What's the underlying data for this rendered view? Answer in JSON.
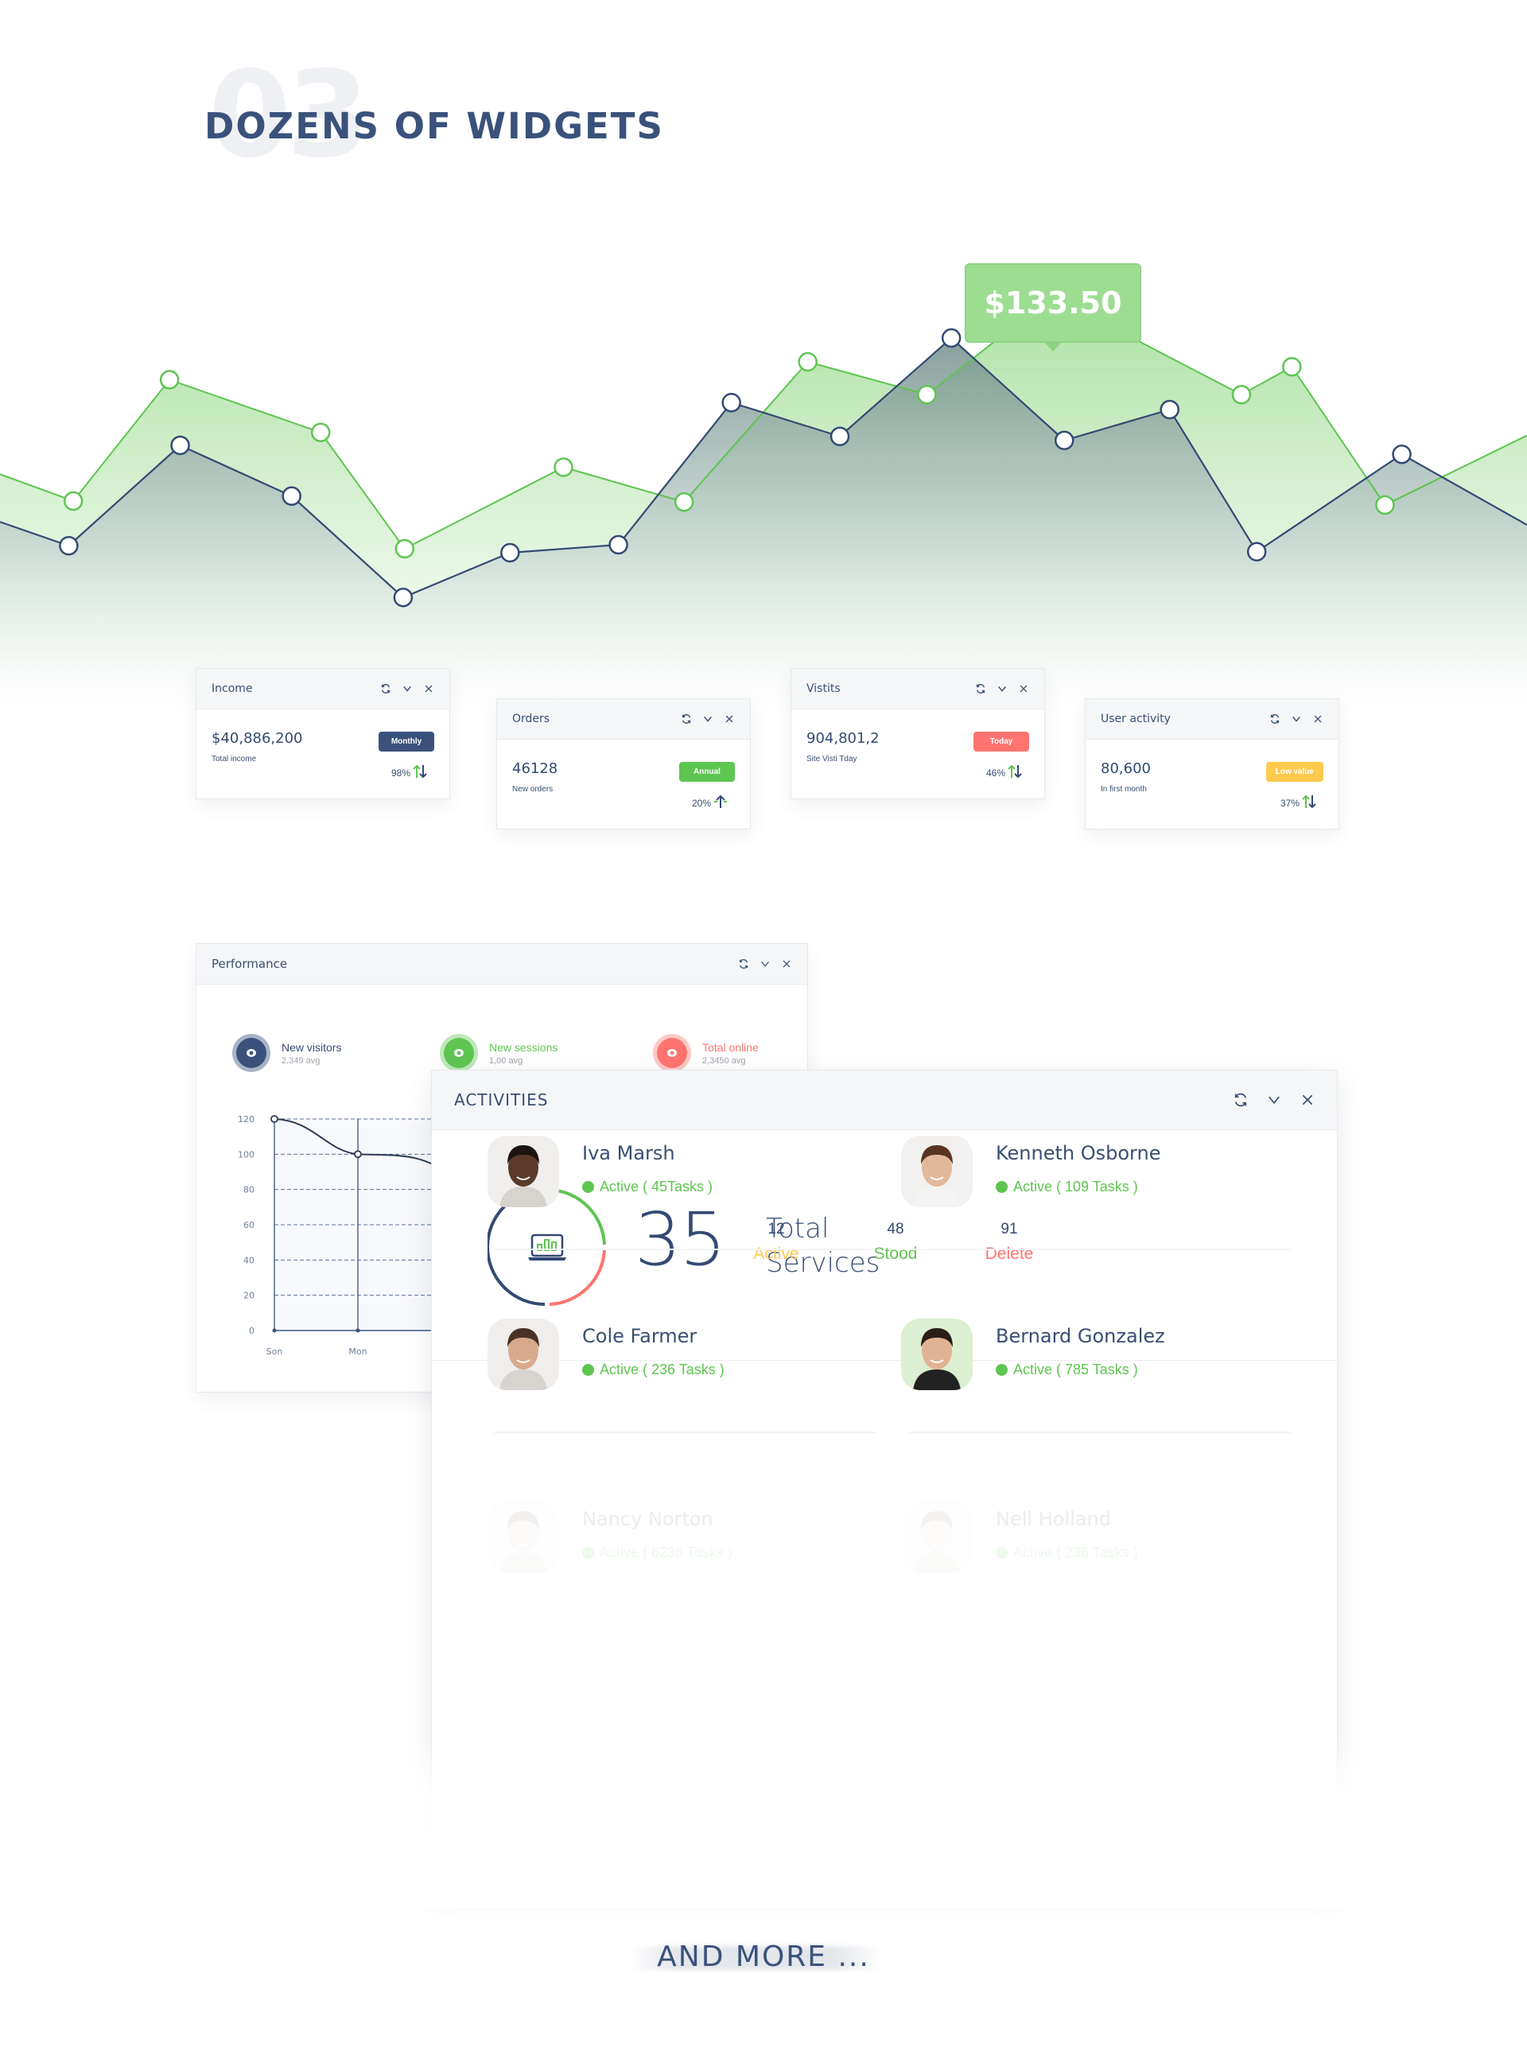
{
  "section": {
    "number": "03",
    "title": "DOZENS OF WIDGETS"
  },
  "colors": {
    "navy": "#344a73",
    "green": "#5ec551",
    "red": "#ff7470",
    "yellow": "#ffc94d",
    "tooltip_green": "#9ddd92"
  },
  "hero_tooltip": {
    "value": "$133.50"
  },
  "chart_data": [
    {
      "type": "area",
      "title": "",
      "xlabel": "",
      "ylabel": "",
      "grid": false,
      "tooltip": {
        "series": "Green",
        "point_index": 9,
        "label": "$133.50"
      },
      "ylim": [
        0,
        480
      ],
      "xlim": [
        0,
        100
      ],
      "series": [
        {
          "name": "Green",
          "color": "#5ec551",
          "x": [
            0,
            4.8,
            11.1,
            21.0,
            26.5,
            36.9,
            44.8,
            52.9,
            60.7,
            68.9,
            81.3,
            84.6,
            90.7,
            100
          ],
          "values": [
            243,
            216,
            338,
            285,
            168,
            250,
            215,
            356,
            323,
            422,
            323,
            351,
            212,
            282
          ]
        },
        {
          "name": "Navy",
          "color": "#344a73",
          "x": [
            0,
            4.5,
            11.8,
            19.1,
            26.4,
            33.4,
            40.5,
            47.9,
            55.0,
            62.3,
            69.7,
            76.6,
            82.3,
            91.8,
            100
          ],
          "values": [
            195,
            171,
            272,
            221,
            119,
            164,
            172,
            315,
            281,
            380,
            277,
            308,
            165,
            263,
            192
          ]
        }
      ]
    },
    {
      "type": "line",
      "title": "Performance",
      "xlabel": "",
      "ylabel": "",
      "grid": true,
      "categories": [
        "Son",
        "Mon"
      ],
      "yticks": [
        0,
        20,
        40,
        60,
        80,
        100,
        120
      ],
      "ylim": [
        0,
        120
      ],
      "series": [
        {
          "name": "Performance",
          "color": "#2f3c55",
          "values": [
            120,
            100,
            90
          ]
        }
      ]
    }
  ],
  "stat_cards": [
    {
      "title": "Income",
      "value": "$40,886,200",
      "label": "Total income",
      "badge": "Monthly",
      "badge_color": "#3a527b",
      "trend": "98%",
      "trend_icon": "up-down-arrows-icon"
    },
    {
      "title": "Orders",
      "value": "46128",
      "label": "New orders",
      "badge": "Annual",
      "badge_color": "#5ec551",
      "trend": "20%",
      "trend_icon": "arrow-up-icon"
    },
    {
      "title": "Vistits",
      "value": "904,801,2",
      "label": "Site Visti Tday",
      "badge": "Today",
      "badge_color": "#ff7470",
      "trend": "46%",
      "trend_icon": "up-down-arrows-icon"
    },
    {
      "title": "User activity",
      "value": "80,600",
      "label": "In first month",
      "badge": "Low value",
      "badge_color": "#ffc94d",
      "trend": "37%",
      "trend_icon": "up-down-arrows-icon"
    }
  ],
  "card_tools": {
    "refresh": "refresh-icon",
    "collapse": "chevron-down-icon",
    "close": "close-icon"
  },
  "performance": {
    "title": "Performance",
    "legend": [
      {
        "label": "New visitors",
        "sub": "2,349 avg",
        "color": "#3a527b",
        "ring": "#a9b3c6",
        "label_color": "#3a4e74"
      },
      {
        "label": "New sessions",
        "sub": "1,00 avg",
        "color": "#5ec551",
        "ring": "#bfe8b9",
        "label_color": "#5ec551"
      },
      {
        "label": "Total online",
        "sub": "2,3450 avg",
        "color": "#ff7470",
        "ring": "#ffc9c7",
        "label_color": "#ff7470"
      }
    ]
  },
  "activities": {
    "title": "ACTIVITIES",
    "total_number": "35",
    "total_label_1": "Total",
    "total_label_2": "Services",
    "icon": "laptop-chart-icon",
    "stats": [
      {
        "number": "12",
        "label": "Active",
        "color": "#ffc94d"
      },
      {
        "number": "48",
        "label": "Stood",
        "color": "#5ec551"
      },
      {
        "number": "91",
        "label": "Delete",
        "color": "#ff7470"
      }
    ],
    "people": [
      {
        "name": "Iva Marsh",
        "status": "Active ( 45Tasks )"
      },
      {
        "name": "Kenneth Osborne",
        "status": "Active ( 109 Tasks )"
      },
      {
        "name": "Cole Farmer",
        "status": "Active ( 236 Tasks )"
      },
      {
        "name": "Bernard Gonzalez",
        "status": "Active ( 785 Tasks )"
      },
      {
        "name": "Nancy Norton",
        "status": "Active ( 6236 Tasks )"
      },
      {
        "name": "Nell Holland",
        "status": "Active ( 236 Tasks )"
      }
    ]
  },
  "footer": {
    "more_label": "AND MORE ..."
  }
}
